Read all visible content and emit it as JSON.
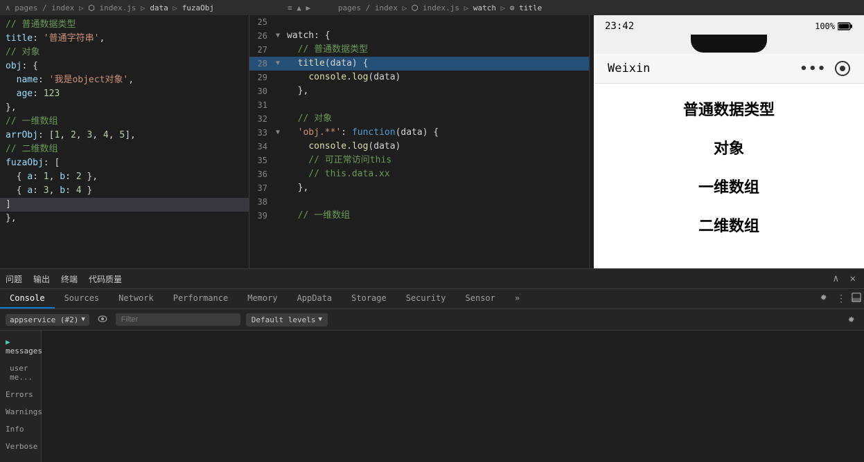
{
  "breadcrumb": {
    "left": "pages / index ▷ index.js ▷ data ▷ fuzaObj",
    "right": "pages / index ▷ index.js ▷ watch ▷ title"
  },
  "code_left": {
    "lines": [
      {
        "indent": 0,
        "text": "// 普通数据类型",
        "cls": "c-comment"
      },
      {
        "indent": 0,
        "text": "title: '普通字符串',",
        "parts": [
          {
            "text": "title",
            "cls": "c-key"
          },
          {
            "text": ": ",
            "cls": "c-white"
          },
          {
            "text": "'普通字符串'",
            "cls": "c-string"
          },
          {
            "text": ",",
            "cls": "c-white"
          }
        ]
      },
      {
        "indent": 0,
        "text": "// 对象",
        "cls": "c-comment"
      },
      {
        "indent": 0,
        "text": "obj: {",
        "parts": [
          {
            "text": "obj",
            "cls": "c-key"
          },
          {
            "text": ": {",
            "cls": "c-white"
          }
        ]
      },
      {
        "indent": 2,
        "text": "  name: '我是object对象',",
        "parts": [
          {
            "text": "  name",
            "cls": "c-key"
          },
          {
            "text": ": ",
            "cls": "c-white"
          },
          {
            "text": "'我是object对象'",
            "cls": "c-string"
          },
          {
            "text": ",",
            "cls": "c-white"
          }
        ]
      },
      {
        "indent": 2,
        "text": "  age: 123",
        "parts": [
          {
            "text": "  age",
            "cls": "c-key"
          },
          {
            "text": ": ",
            "cls": "c-white"
          },
          {
            "text": "123",
            "cls": "c-number"
          }
        ]
      },
      {
        "indent": 0,
        "text": "},",
        "cls": "c-white"
      },
      {
        "indent": 0,
        "text": "// 一维数组",
        "cls": "c-comment"
      },
      {
        "indent": 0,
        "text": "arrObj: [1, 2, 3, 4, 5],",
        "parts": [
          {
            "text": "arrObj",
            "cls": "c-key"
          },
          {
            "text": ": [",
            "cls": "c-white"
          },
          {
            "text": "1",
            "cls": "c-number"
          },
          {
            "text": ", ",
            "cls": "c-white"
          },
          {
            "text": "2",
            "cls": "c-number"
          },
          {
            "text": ", ",
            "cls": "c-white"
          },
          {
            "text": "3",
            "cls": "c-number"
          },
          {
            "text": ", ",
            "cls": "c-white"
          },
          {
            "text": "4",
            "cls": "c-number"
          },
          {
            "text": ", ",
            "cls": "c-white"
          },
          {
            "text": "5",
            "cls": "c-number"
          },
          {
            "text": "],",
            "cls": "c-white"
          }
        ]
      },
      {
        "indent": 0,
        "text": "// 二维数组",
        "cls": "c-comment"
      },
      {
        "indent": 0,
        "text": "fuzaObj: [",
        "parts": [
          {
            "text": "fuzaObj",
            "cls": "c-key"
          },
          {
            "text": ": [",
            "cls": "c-white"
          }
        ]
      },
      {
        "indent": 2,
        "text": "  { a: 1, b: 2 },",
        "parts": [
          {
            "text": "  { ",
            "cls": "c-white"
          },
          {
            "text": "a",
            "cls": "c-key"
          },
          {
            "text": ": ",
            "cls": "c-white"
          },
          {
            "text": "1",
            "cls": "c-number"
          },
          {
            "text": ", ",
            "cls": "c-white"
          },
          {
            "text": "b",
            "cls": "c-key"
          },
          {
            "text": ": ",
            "cls": "c-white"
          },
          {
            "text": "2",
            "cls": "c-number"
          },
          {
            "text": " },",
            "cls": "c-white"
          }
        ]
      },
      {
        "indent": 2,
        "text": "  { a: 3, b: 4 }",
        "parts": [
          {
            "text": "  { ",
            "cls": "c-white"
          },
          {
            "text": "a",
            "cls": "c-key"
          },
          {
            "text": ": ",
            "cls": "c-white"
          },
          {
            "text": "3",
            "cls": "c-number"
          },
          {
            "text": ", ",
            "cls": "c-white"
          },
          {
            "text": "b",
            "cls": "c-key"
          },
          {
            "text": ": ",
            "cls": "c-white"
          },
          {
            "text": "4",
            "cls": "c-number"
          },
          {
            "text": " }",
            "cls": "c-white"
          }
        ]
      },
      {
        "indent": 0,
        "text": "]",
        "cls": "c-white"
      },
      {
        "indent": 0,
        "text": "},",
        "cls": "c-white"
      }
    ]
  },
  "code_right": {
    "lines": [
      {
        "num": 25,
        "arrow": "",
        "indent": "",
        "highlighted": false
      },
      {
        "num": 26,
        "arrow": "▼",
        "content": "watch: {",
        "highlighted": false
      },
      {
        "num": 27,
        "arrow": "",
        "content": "  // 普通数据类型",
        "highlighted": false,
        "cls": "c-comment"
      },
      {
        "num": 28,
        "arrow": "▼",
        "content_parts": [
          {
            "text": "  title(data) {",
            "cls": "c-white"
          }
        ],
        "highlighted": true
      },
      {
        "num": 29,
        "arrow": "",
        "content_parts": [
          {
            "text": "    console",
            "cls": "c-func"
          },
          {
            "text": ".",
            "cls": "c-white"
          },
          {
            "text": "log",
            "cls": "c-func"
          },
          {
            "text": "(data)",
            "cls": "c-white"
          }
        ],
        "highlighted": false
      },
      {
        "num": 30,
        "arrow": "",
        "content": "  },",
        "highlighted": false
      },
      {
        "num": 31,
        "arrow": "",
        "content": "",
        "highlighted": false
      },
      {
        "num": 32,
        "arrow": "",
        "content": "  // 对象",
        "highlighted": false,
        "cls": "c-comment"
      },
      {
        "num": 33,
        "arrow": "▼",
        "content_parts": [
          {
            "text": "  'obj.**': ",
            "cls": "c-white"
          },
          {
            "text": "function",
            "cls": "c-keyword"
          },
          {
            "text": "(data) {",
            "cls": "c-white"
          }
        ],
        "highlighted": false
      },
      {
        "num": 34,
        "arrow": "",
        "content_parts": [
          {
            "text": "    console",
            "cls": "c-func"
          },
          {
            "text": ".",
            "cls": "c-white"
          },
          {
            "text": "log",
            "cls": "c-func"
          },
          {
            "text": "(data)",
            "cls": "c-white"
          }
        ],
        "highlighted": false
      },
      {
        "num": 35,
        "arrow": "",
        "content": "    // 可正常访问this",
        "highlighted": false,
        "cls": "c-comment"
      },
      {
        "num": 36,
        "arrow": "",
        "content": "    // this.data.xx",
        "highlighted": false,
        "cls": "c-comment"
      },
      {
        "num": 37,
        "arrow": "",
        "content": "  },",
        "highlighted": false
      },
      {
        "num": 38,
        "arrow": "",
        "content": "",
        "highlighted": false
      },
      {
        "num": 39,
        "arrow": "",
        "content": "  // 一维数组",
        "highlighted": false,
        "cls": "c-comment"
      }
    ]
  },
  "phone": {
    "time": "23:42",
    "battery": "100%",
    "title": "Weixin",
    "sections": [
      {
        "label": "普通数据类型"
      },
      {
        "label": "对象"
      },
      {
        "label": "一维数组"
      },
      {
        "label": "二维数组"
      }
    ]
  },
  "devtools": {
    "header_items": [
      "问题",
      "输出",
      "终端",
      "代码质量"
    ],
    "tabs": [
      {
        "label": "Console",
        "active": true
      },
      {
        "label": "Sources",
        "active": false
      },
      {
        "label": "Network",
        "active": false
      },
      {
        "label": "Performance",
        "active": false
      },
      {
        "label": "Memory",
        "active": false
      },
      {
        "label": "AppData",
        "active": false
      },
      {
        "label": "Storage",
        "active": false
      },
      {
        "label": "Security",
        "active": false
      },
      {
        "label": "Sensor",
        "active": false
      },
      {
        "label": "»",
        "active": false
      }
    ],
    "console_context": "appservice (#2)",
    "filter_placeholder": "Filter",
    "default_levels": "Default levels",
    "sidebar_items": [
      {
        "label": "messages",
        "active": false
      },
      {
        "label": "user me...",
        "active": false
      },
      {
        "label": "Errors",
        "active": false
      },
      {
        "label": "Warnings",
        "active": false
      },
      {
        "label": "Info",
        "active": false
      },
      {
        "label": "Verbose",
        "active": false
      }
    ]
  }
}
